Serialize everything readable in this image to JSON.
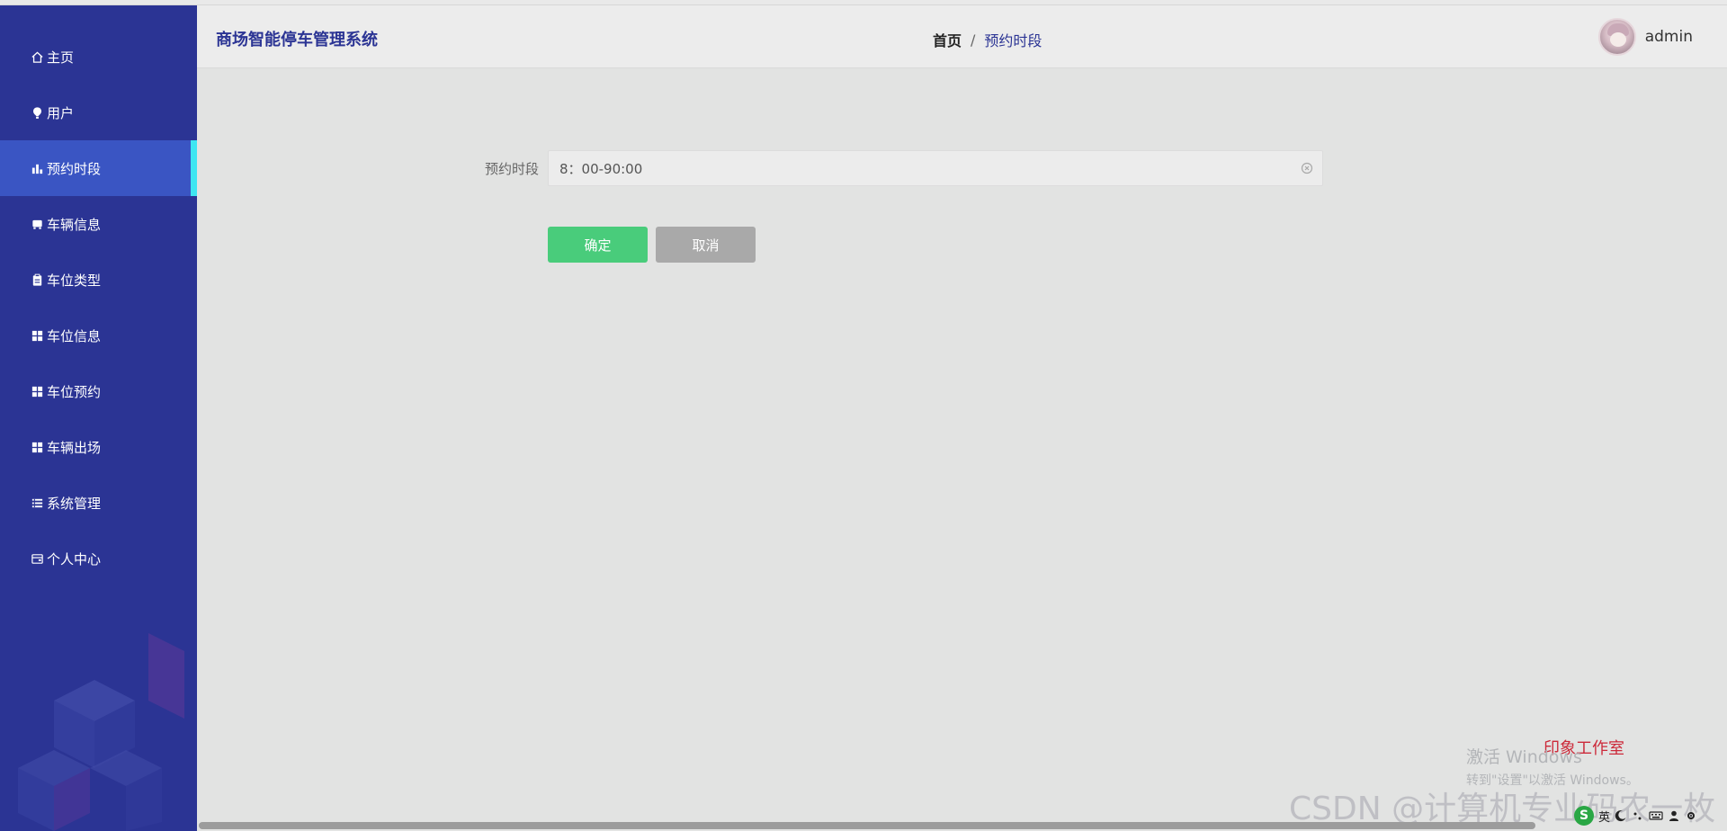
{
  "header": {
    "app_title": "商场智能停车管理系统",
    "breadcrumb": {
      "home": "首页",
      "separator": "/",
      "current": "预约时段"
    },
    "user": {
      "name": "admin"
    }
  },
  "sidebar": {
    "items": [
      {
        "label": "主页",
        "icon": "home-icon",
        "active": false
      },
      {
        "label": "用户",
        "icon": "pin-icon",
        "active": false
      },
      {
        "label": "预约时段",
        "icon": "bar-chart-icon",
        "active": true
      },
      {
        "label": "车辆信息",
        "icon": "car-icon",
        "active": false
      },
      {
        "label": "车位类型",
        "icon": "clipboard-icon",
        "active": false
      },
      {
        "label": "车位信息",
        "icon": "grid-icon",
        "active": false
      },
      {
        "label": "车位预约",
        "icon": "grid-icon",
        "active": false
      },
      {
        "label": "车辆出场",
        "icon": "grid-icon",
        "active": false
      },
      {
        "label": "系统管理",
        "icon": "list-icon",
        "active": false
      },
      {
        "label": "个人中心",
        "icon": "wallet-icon",
        "active": false
      }
    ]
  },
  "form": {
    "time_slot": {
      "label": "预约时段",
      "value": "8：00-90:00"
    },
    "confirm_label": "确定",
    "cancel_label": "取消"
  },
  "watermarks": {
    "activate_title": "激活 Windows",
    "activate_sub": "转到\"设置\"以激活 Windows。",
    "studio": "印象工作室",
    "csdn": "CSDN @计算机专业码农一枚"
  },
  "tray": {
    "ime_badge": "S",
    "ime_lang": "英"
  },
  "colors": {
    "sidebar_bg": "#2b3494",
    "sidebar_active": "#3a55c3",
    "active_indicator": "#3ee6f2",
    "confirm_button": "#49cc7b",
    "cancel_button": "#a9a9a9"
  }
}
